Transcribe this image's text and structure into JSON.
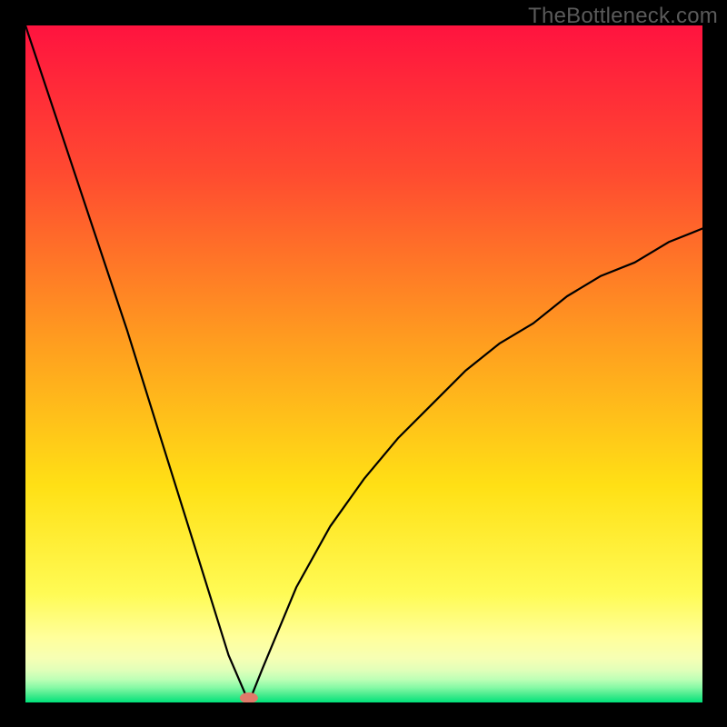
{
  "meta": {
    "attribution": "TheBottleneck.com"
  },
  "chart_data": {
    "type": "line",
    "title": "",
    "xlabel": "",
    "ylabel": "",
    "xlim": [
      0,
      100
    ],
    "ylim": [
      0,
      100
    ],
    "categories": [
      0,
      5,
      10,
      15,
      20,
      25,
      30,
      33,
      35,
      40,
      45,
      50,
      55,
      60,
      65,
      70,
      75,
      80,
      85,
      90,
      95,
      100
    ],
    "values": [
      100,
      85,
      70,
      55,
      39,
      23,
      7,
      0,
      5,
      17,
      26,
      33,
      39,
      44,
      49,
      53,
      56,
      60,
      63,
      65,
      68,
      70
    ],
    "minimum_x": 33,
    "marker": {
      "x": 33,
      "y": 0,
      "color": "#e07a6a"
    },
    "annotations": [],
    "background_gradient_stops": [
      {
        "offset": 0.0,
        "color": "#ff133f"
      },
      {
        "offset": 0.22,
        "color": "#ff4b30"
      },
      {
        "offset": 0.47,
        "color": "#ff9e1f"
      },
      {
        "offset": 0.68,
        "color": "#ffe015"
      },
      {
        "offset": 0.84,
        "color": "#fffb55"
      },
      {
        "offset": 0.905,
        "color": "#ffff9c"
      },
      {
        "offset": 0.935,
        "color": "#f6ffb4"
      },
      {
        "offset": 0.952,
        "color": "#e1ffb9"
      },
      {
        "offset": 0.966,
        "color": "#bdffb6"
      },
      {
        "offset": 0.978,
        "color": "#86f9a5"
      },
      {
        "offset": 0.988,
        "color": "#4cec8f"
      },
      {
        "offset": 1.0,
        "color": "#00e27a"
      }
    ]
  }
}
